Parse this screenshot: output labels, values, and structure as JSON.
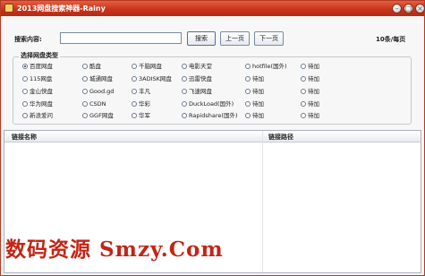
{
  "window": {
    "title": "2013网盘搜索神器-Rainy",
    "controls": [
      "minimize",
      "maximize",
      "close"
    ]
  },
  "search": {
    "label": "搜索内容:",
    "value": "",
    "placeholder": "",
    "search_button": "搜索",
    "prev_button": "上一页",
    "next_button": "下一页",
    "per_page": "10条/每页"
  },
  "disk_types": {
    "title": "选择网盘类型",
    "selected": "百度网盘",
    "options": [
      [
        "百度网盘",
        "酷盘",
        "千脑网盘",
        "电影天堂",
        "hotfile(国外)",
        "待加"
      ],
      [
        "115网盘",
        "城通网盘",
        "3ADISK网盘",
        "迅雷快盘",
        "待加",
        "待加"
      ],
      [
        "金山快盘",
        "Good.gd",
        "丰凡",
        "飞速网盘",
        "待加",
        "待加"
      ],
      [
        "华为网盘",
        "CSDN",
        "华彩",
        "DuckLoad(国外)",
        "待加",
        "待加"
      ],
      [
        "新浪爱问",
        "GGF网盘",
        "华军",
        "Rapidshare(国外)",
        "待加",
        "待加"
      ]
    ]
  },
  "results": {
    "columns": [
      "链接名称",
      "链接路径"
    ],
    "rows": []
  },
  "watermark": "数码资源 Smzy.Com",
  "colors": {
    "titlebar": "#c8341c",
    "watermark": "#c22516",
    "accent_border": "#7a8aa0"
  }
}
